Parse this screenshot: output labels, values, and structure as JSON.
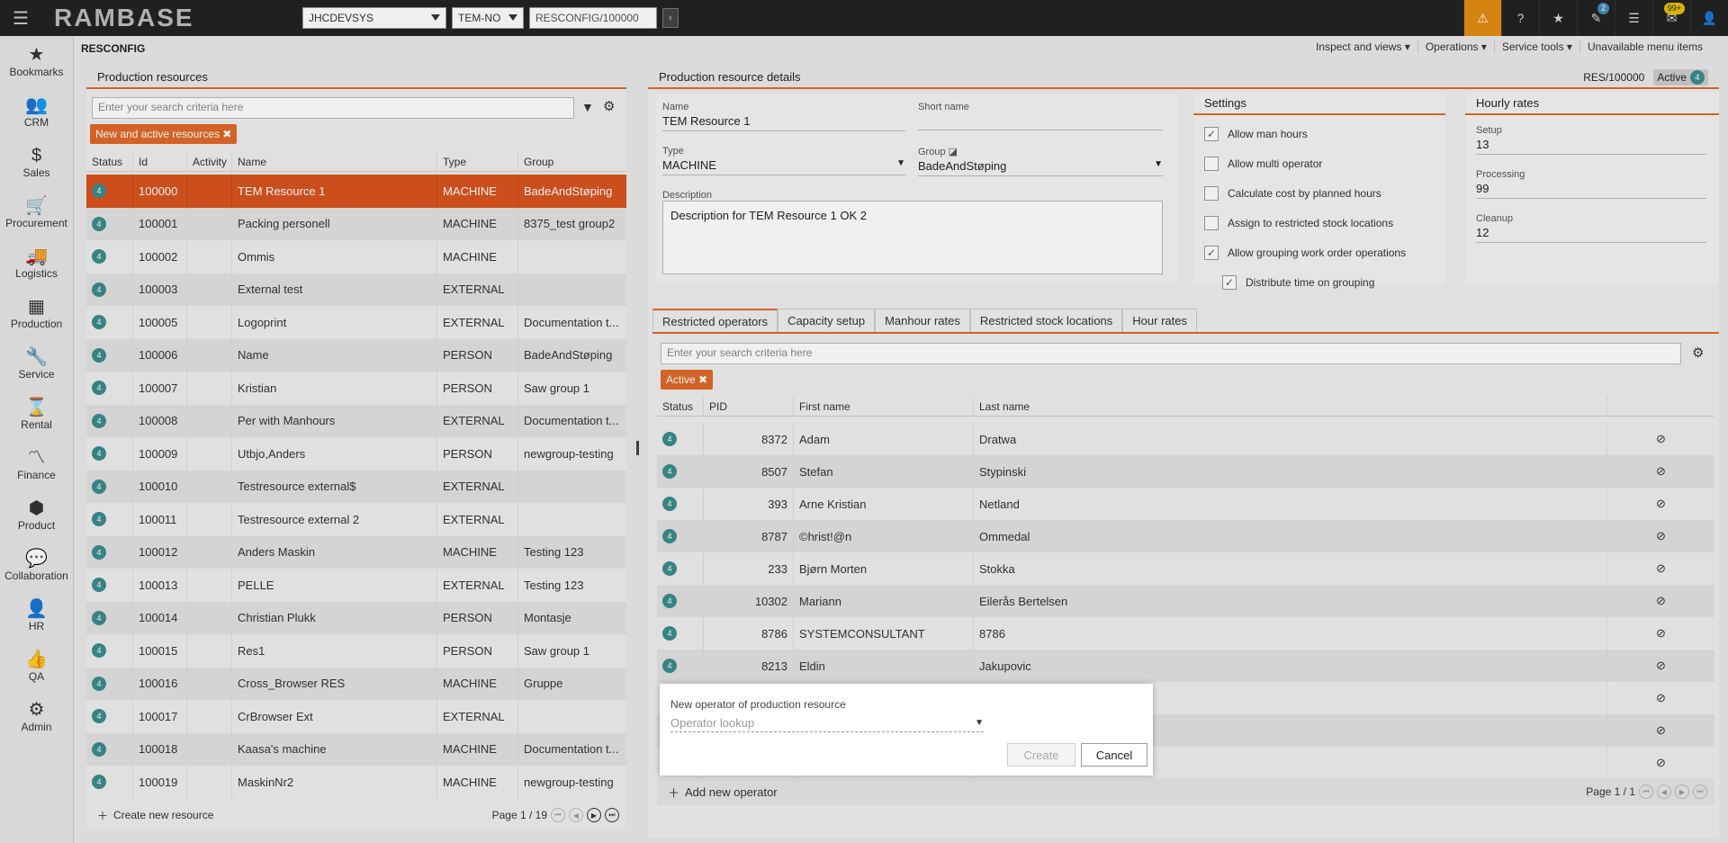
{
  "topbar": {
    "logo": "RAMBASE",
    "company": "JHCDEVSYS",
    "lang": "TEM-NO",
    "path": "RESCONFIG/100000",
    "badge_tasks": "2",
    "badge_mail": "99+"
  },
  "sidebar": [
    {
      "label": "Bookmarks",
      "icon": "star"
    },
    {
      "label": "CRM",
      "icon": "people"
    },
    {
      "label": "Sales",
      "icon": "money-bag"
    },
    {
      "label": "Procurement",
      "icon": "cart"
    },
    {
      "label": "Logistics",
      "icon": "truck"
    },
    {
      "label": "Production",
      "icon": "boxes"
    },
    {
      "label": "Service",
      "icon": "wrench"
    },
    {
      "label": "Rental",
      "icon": "rental"
    },
    {
      "label": "Finance",
      "icon": "chart-line"
    },
    {
      "label": "Product",
      "icon": "cube"
    },
    {
      "label": "Collaboration",
      "icon": "chat"
    },
    {
      "label": "HR",
      "icon": "person"
    },
    {
      "label": "QA",
      "icon": "thumbs-up"
    },
    {
      "label": "Admin",
      "icon": "gear"
    }
  ],
  "page": {
    "title": "RESCONFIG",
    "menus": [
      "Inspect and views ▾",
      "Operations ▾",
      "Service tools ▾",
      "Unavailable menu items"
    ]
  },
  "left": {
    "title": "Production resources",
    "search_placeholder": "Enter your search criteria here",
    "chip": "New and active resources",
    "columns": [
      "Status",
      "Id",
      "Activity",
      "Name",
      "Type",
      "Group"
    ],
    "rows": [
      {
        "status": "4",
        "id": "100000",
        "name": "TEM Resource 1",
        "type": "MACHINE",
        "group": "BadeAndStøping"
      },
      {
        "status": "4",
        "id": "100001",
        "name": "Packing personell",
        "type": "MACHINE",
        "group": "8375_test group2"
      },
      {
        "status": "4",
        "id": "100002",
        "name": "Ommis",
        "type": "MACHINE",
        "group": ""
      },
      {
        "status": "4",
        "id": "100003",
        "name": "External test",
        "type": "EXTERNAL",
        "group": ""
      },
      {
        "status": "4",
        "id": "100005",
        "name": "Logoprint",
        "type": "EXTERNAL",
        "group": "Documentation t..."
      },
      {
        "status": "4",
        "id": "100006",
        "name": "Name",
        "type": "PERSON",
        "group": "BadeAndStøping"
      },
      {
        "status": "4",
        "id": "100007",
        "name": "Kristian",
        "type": "PERSON",
        "group": "Saw group 1"
      },
      {
        "status": "4",
        "id": "100008",
        "name": "Per with Manhours",
        "type": "EXTERNAL",
        "group": "Documentation t..."
      },
      {
        "status": "4",
        "id": "100009",
        "name": "Utbjo,Anders",
        "type": "PERSON",
        "group": "newgroup-testing"
      },
      {
        "status": "4",
        "id": "100010",
        "name": "Testresource external$",
        "type": "EXTERNAL",
        "group": ""
      },
      {
        "status": "4",
        "id": "100011",
        "name": "Testresource external 2",
        "type": "EXTERNAL",
        "group": ""
      },
      {
        "status": "4",
        "id": "100012",
        "name": "Anders Maskin",
        "type": "MACHINE",
        "group": "Testing 123"
      },
      {
        "status": "4",
        "id": "100013",
        "name": "PELLE",
        "type": "EXTERNAL",
        "group": "Testing 123"
      },
      {
        "status": "4",
        "id": "100014",
        "name": "Christian Plukk",
        "type": "PERSON",
        "group": "Montasje"
      },
      {
        "status": "4",
        "id": "100015",
        "name": "Res1",
        "type": "PERSON",
        "group": "Saw group 1"
      },
      {
        "status": "4",
        "id": "100016",
        "name": "Cross_Browser RES",
        "type": "MACHINE",
        "group": "Gruppe"
      },
      {
        "status": "4",
        "id": "100017",
        "name": "CrBrowser Ext",
        "type": "EXTERNAL",
        "group": ""
      },
      {
        "status": "4",
        "id": "100018",
        "name": "Kaasa's machine",
        "type": "MACHINE",
        "group": "Documentation t..."
      },
      {
        "status": "4",
        "id": "100019",
        "name": "MaskinNr2",
        "type": "MACHINE",
        "group": "newgroup-testing"
      }
    ],
    "create_label": "Create new resource",
    "page_info": "Page 1 / 19"
  },
  "right": {
    "title": "Production resource details",
    "ref": "RES/100000",
    "status_text": "Active",
    "status_num": "4",
    "name_label": "Name",
    "name": "TEM Resource 1",
    "short_label": "Short name",
    "short": "",
    "type_label": "Type",
    "type": "MACHINE",
    "group_label": "Group",
    "group": "BadeAndStøping",
    "desc_label": "Description",
    "desc": "Description for TEM Resource 1 OK 2",
    "settings_title": "Settings",
    "settings": [
      {
        "label": "Allow man hours",
        "checked": "✓"
      },
      {
        "label": "Allow multi operator",
        "checked": ""
      },
      {
        "label": "Calculate cost by planned hours",
        "checked": ""
      },
      {
        "label": "Assign to restricted stock locations",
        "checked": ""
      },
      {
        "label": "Allow grouping work order operations",
        "checked": "✓"
      },
      {
        "label": "Distribute time on grouping",
        "checked": "✓"
      }
    ],
    "rates_title": "Hourly rates",
    "setup_label": "Setup",
    "setup": "13",
    "proc_label": "Processing",
    "proc": "99",
    "clean_label": "Cleanup",
    "clean": "12",
    "tabs": [
      "Restricted operators",
      "Capacity setup",
      "Manhour rates",
      "Restricted stock locations",
      "Hour rates"
    ],
    "op_search": "Enter your search criteria here",
    "op_chip": "Active",
    "op_columns": [
      "Status",
      "PID",
      "First name",
      "Last name"
    ],
    "operators": [
      {
        "status": "4",
        "pid": "8372",
        "first": "Adam",
        "last": "Dratwa"
      },
      {
        "status": "4",
        "pid": "8507",
        "first": "Stefan",
        "last": "Stypinski"
      },
      {
        "status": "4",
        "pid": "393",
        "first": "Arne Kristian",
        "last": "Netland"
      },
      {
        "status": "4",
        "pid": "8787",
        "first": "©hrist!@n",
        "last": "Ommedal"
      },
      {
        "status": "4",
        "pid": "233",
        "first": "Bjørn Morten",
        "last": "Stokka"
      },
      {
        "status": "4",
        "pid": "10302",
        "first": "Mariann",
        "last": "Eilerås Bertelsen"
      },
      {
        "status": "4",
        "pid": "8786",
        "first": "SYSTEMCONSULTANT",
        "last": "8786"
      },
      {
        "status": "4",
        "pid": "8213",
        "first": "Eldin",
        "last": "Jakupovic"
      }
    ],
    "add_label": "Add new operator",
    "page_info": "Page 1 / 1"
  },
  "dialog": {
    "label": "New operator of production resource",
    "placeholder": "Operator lookup",
    "create": "Create",
    "cancel": "Cancel"
  }
}
